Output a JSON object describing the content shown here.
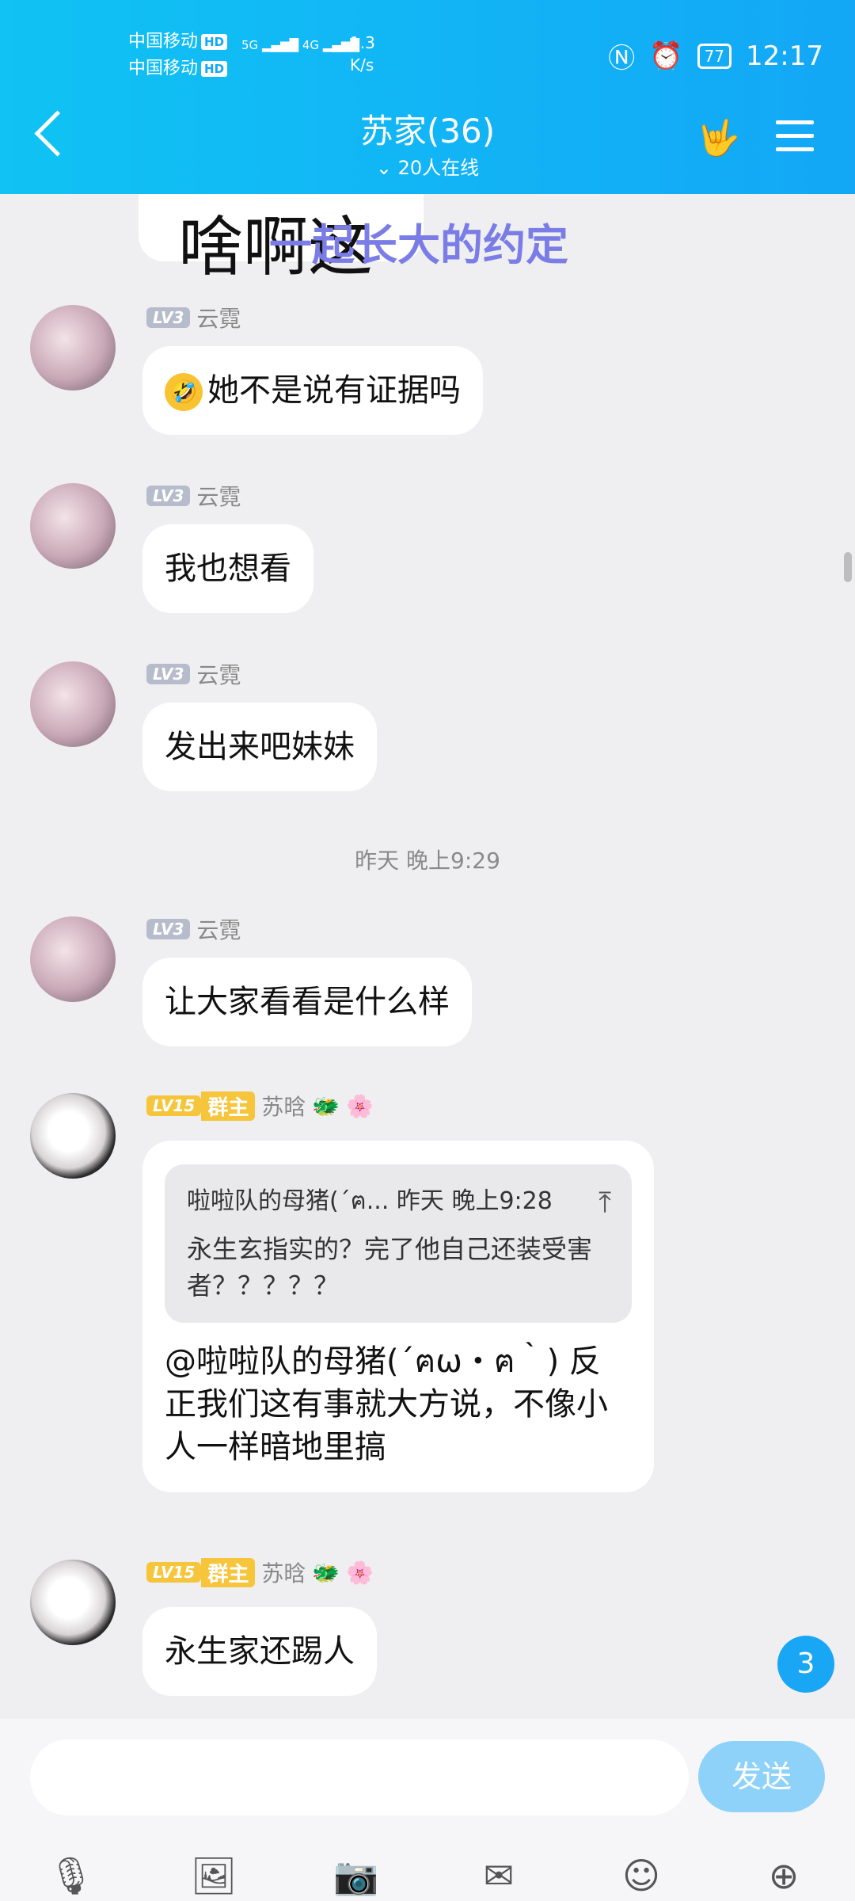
{
  "status_bar": {
    "carrier1": "中国移动",
    "carrier2": "中国移动",
    "hd": "HD",
    "signal_5g": "5G",
    "signal_4g": "4G",
    "speed": "1.3",
    "speed_unit": "K/s",
    "battery": "77",
    "time": "12:17"
  },
  "header": {
    "title": "苏家(36)",
    "online": "20人在线"
  },
  "sticker": {
    "text": "啥啊这",
    "overlay": "一起长大的约定"
  },
  "messages": [
    {
      "level": "LV3",
      "name": "云霓",
      "text": "她不是说有证据吗"
    },
    {
      "level": "LV3",
      "name": "云霓",
      "text": "我也想看"
    },
    {
      "level": "LV3",
      "name": "云霓",
      "text": "发出来吧妹妹"
    },
    {
      "level": "LV3",
      "name": "云霓",
      "text": "让大家看看是什么样"
    },
    {
      "level": "LV15",
      "role": "群主",
      "name": "苏晗",
      "quote_head": "啦啦队的母猪(´ฅ... 昨天 晚上9:28",
      "quote_text": "永生玄指实的？完了他自己还装受害者？？？？？",
      "text": "@啦啦队的母猪(´ฅω・ฅ｀) 反正我们这有事就大方说，不像小人一样暗地里搞"
    },
    {
      "level": "LV15",
      "role": "群主",
      "name": "苏晗",
      "text": "永生家还踢人"
    }
  ],
  "timestamp": "昨天 晚上9:29",
  "unread_count": "3",
  "input": {
    "placeholder": "",
    "send_label": "发送"
  },
  "icons": [
    "microphone-icon",
    "image-icon",
    "camera-icon",
    "red-packet-icon",
    "emoji-icon",
    "plus-icon"
  ]
}
